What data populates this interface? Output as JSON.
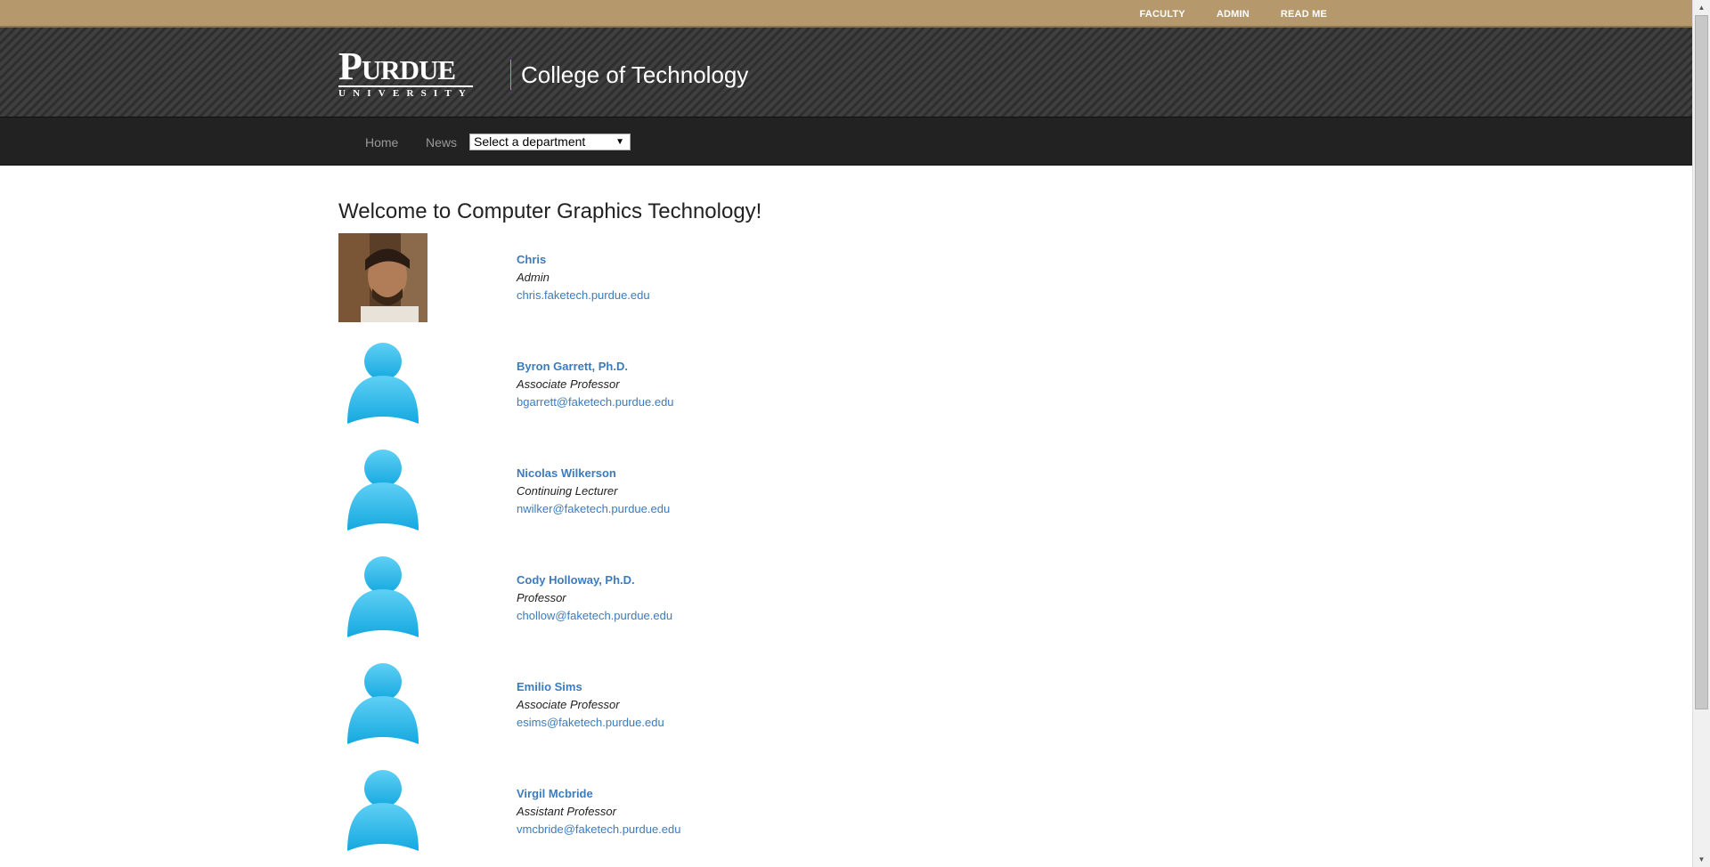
{
  "utility_nav": {
    "links": [
      "FACULTY",
      "ADMIN",
      "READ ME"
    ]
  },
  "header": {
    "logo_main": "Purdue",
    "logo_sub": "UNIVERSITY",
    "title": "College of Technology"
  },
  "nav": {
    "home": "Home",
    "news": "News",
    "department_select": "Select a department"
  },
  "main": {
    "heading": "Welcome to Computer Graphics Technology!",
    "faculty": [
      {
        "name": "Chris",
        "role": "Admin",
        "email": "chris.faketech.purdue.edu",
        "photo": "profile-photo"
      },
      {
        "name": "Byron Garrett, Ph.D.",
        "role": "Associate Professor",
        "email": "bgarrett@faketech.purdue.edu",
        "photo": "default-avatar-icon"
      },
      {
        "name": "Nicolas Wilkerson",
        "role": "Continuing Lecturer",
        "email": "nwilker@faketech.purdue.edu",
        "photo": "default-avatar-icon"
      },
      {
        "name": "Cody Holloway, Ph.D.",
        "role": "Professor",
        "email": "chollow@faketech.purdue.edu",
        "photo": "default-avatar-icon"
      },
      {
        "name": "Emilio Sims",
        "role": "Associate Professor",
        "email": "esims@faketech.purdue.edu",
        "photo": "default-avatar-icon"
      },
      {
        "name": "Virgil Mcbride",
        "role": "Assistant Professor",
        "email": "vmcbride@faketech.purdue.edu",
        "photo": "default-avatar-icon"
      }
    ]
  },
  "colors": {
    "utility_bar": "#b5986c",
    "header_bg": "#3a3a3a",
    "nav_bg": "#222222",
    "link": "#3b7bbf",
    "avatar": "#29b6ea"
  }
}
